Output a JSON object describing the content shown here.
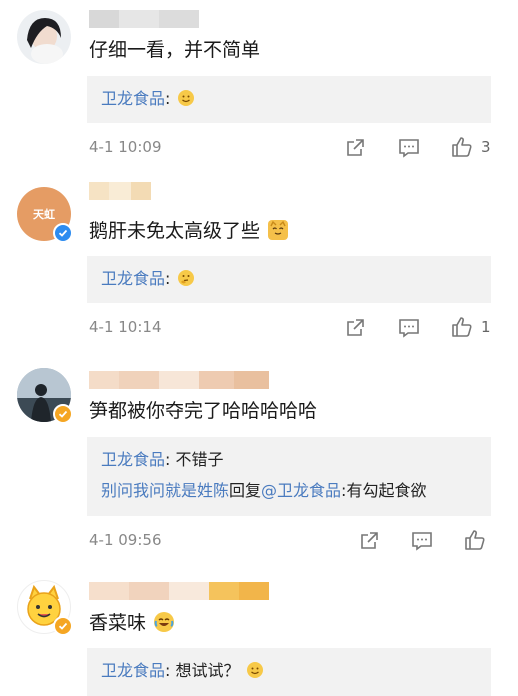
{
  "comments": [
    {
      "text": "仔细一看，并不简单",
      "replies": [
        {
          "author": "卫龙食品",
          "sep": ":",
          "body": ""
        }
      ],
      "time": "4-1 10:09",
      "likes": "3"
    },
    {
      "text": "鹅肝未免太高级了些",
      "avatar_text": "天虹",
      "replies": [
        {
          "author": "卫龙食品",
          "sep": ":",
          "body": ""
        }
      ],
      "time": "4-1 10:14",
      "likes": "1"
    },
    {
      "text": "笋都被你夺完了哈哈哈哈哈",
      "replies": [
        {
          "author": "卫龙食品",
          "sep": ":",
          "body": " 不错子"
        },
        {
          "author": "别问我问就是姓陈",
          "mid": "回复",
          "mention": "@卫龙食品",
          "sep": ":",
          "body": "有勾起食欲"
        }
      ],
      "time": "4-1 09:56",
      "likes": ""
    },
    {
      "text": "香菜味",
      "replies": [
        {
          "author": "卫龙食品",
          "sep": ":",
          "body": " 想试试？"
        }
      ]
    }
  ],
  "colors": {
    "link_blue": "#4a7bbf",
    "reply_bg": "#f2f2f2",
    "verified_blue": "#2d8cf0",
    "verified_gold": "#f5a623"
  },
  "icons": [
    "share-icon",
    "comment-icon",
    "like-icon",
    "smile-emoji",
    "thinking-emoji",
    "cat-emoji",
    "laugh-cry-emoji"
  ]
}
